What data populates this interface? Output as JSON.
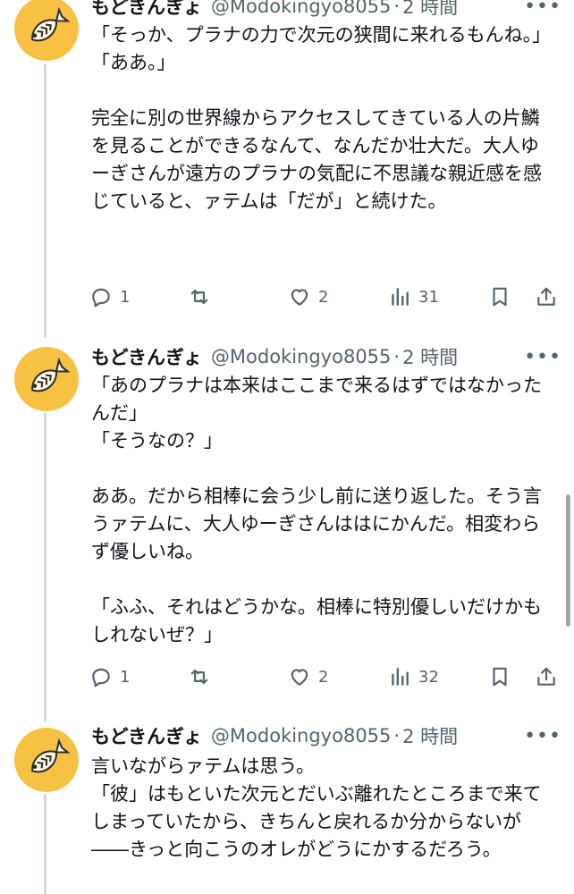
{
  "tweets": [
    {
      "name": "もどきんぎょ",
      "handle": "@Modokingyo8055",
      "separator": "·",
      "time": "2 時間",
      "lines": [
        "「そっか、プラナの力で次元の狭間に来れるもんね。」",
        "「ああ。」",
        "",
        "完全に別の世界線からアクセスしてきている人の片鱗を見ることができるなんて、なんだか壮大だ。大人ゆーぎさんが遠方のプラナの気配に不思議な親近感を感じていると、ァテムは「だが」と続けた。"
      ],
      "replies": "1",
      "retweets": "",
      "likes": "2",
      "views": "31"
    },
    {
      "name": "もどきんぎょ",
      "handle": "@Modokingyo8055",
      "separator": "·",
      "time": "2 時間",
      "lines": [
        "「あのプラナは本来はここまで来るはずではなかったんだ」",
        "「そうなの？」",
        "",
        "ああ。だから相棒に会う少し前に送り返した。そう言うァテムに、大人ゆーぎさんははにかんだ。相変わらず優しいね。",
        "",
        "「ふふ、それはどうかな。相棒に特別優しいだけかもしれないぜ？」"
      ],
      "replies": "1",
      "retweets": "",
      "likes": "2",
      "views": "32"
    },
    {
      "name": "もどきんぎょ",
      "handle": "@Modokingyo8055",
      "separator": "·",
      "time": "2 時間",
      "lines": [
        "言いながらァテムは思う。",
        "「彼」はもといた次元とだいぶ離れたところまで来てしまっていたから、きちんと戻れるか分からないが――きっと向こうのオレがどうにかするだろう。"
      ]
    }
  ],
  "icons": {
    "avatar": "goldfish-icon",
    "more": "more-icon",
    "reply": "reply-icon",
    "retweet": "retweet-icon",
    "like": "heart-icon",
    "views": "views-icon",
    "bookmark": "bookmark-icon",
    "share": "share-icon"
  },
  "colors": {
    "avatar_bg": "#f7c244",
    "secondary_text": "#536471",
    "thread_line": "#cfd9de"
  }
}
